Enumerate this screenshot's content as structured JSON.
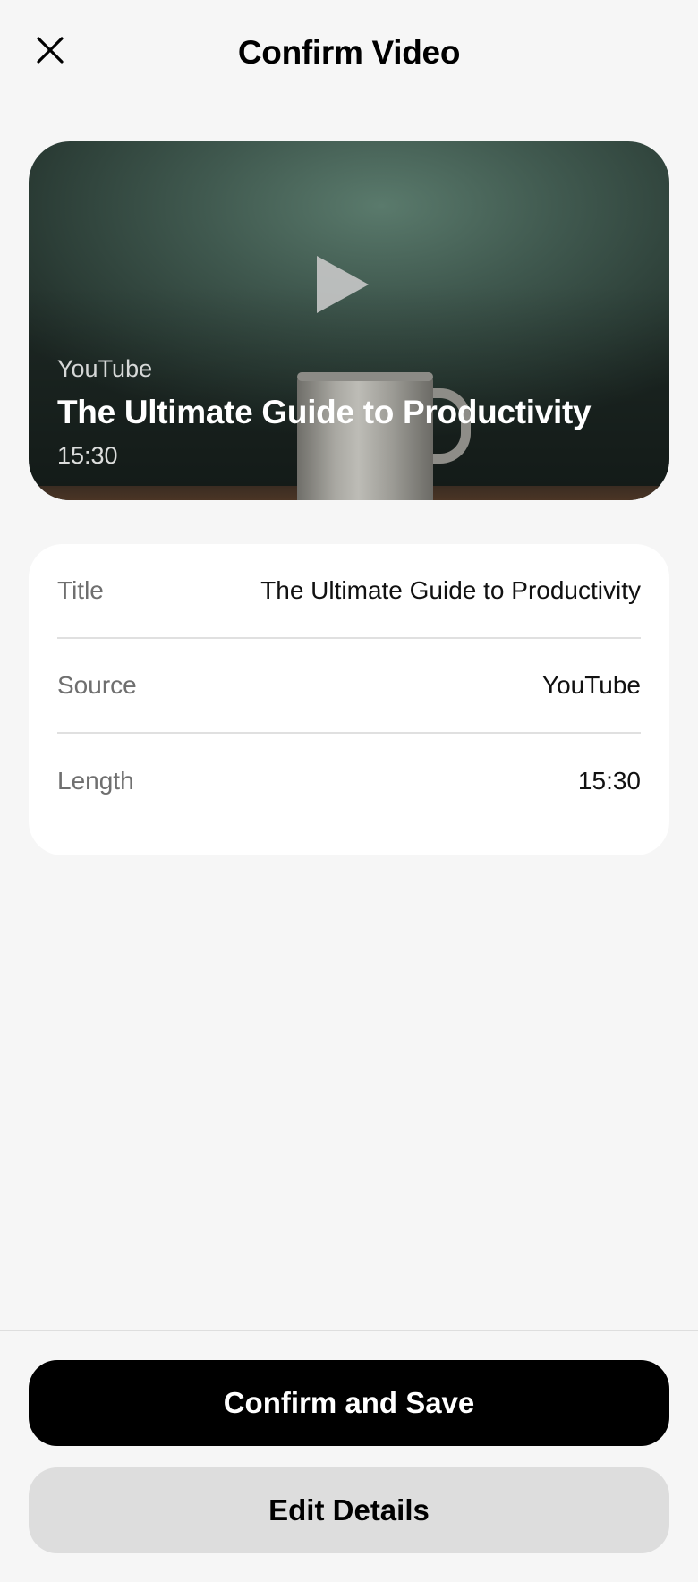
{
  "header": {
    "title": "Confirm Video",
    "close_icon": "close-icon"
  },
  "preview": {
    "source": "YouTube",
    "title": "The Ultimate Guide to Productivity",
    "length": "15:30",
    "play_icon": "play-icon"
  },
  "details": {
    "rows": [
      {
        "label": "Title",
        "value": "The Ultimate Guide to Productivity"
      },
      {
        "label": "Source",
        "value": "YouTube"
      },
      {
        "label": "Length",
        "value": "15:30"
      }
    ]
  },
  "actions": {
    "confirm_label": "Confirm and Save",
    "edit_label": "Edit Details"
  }
}
